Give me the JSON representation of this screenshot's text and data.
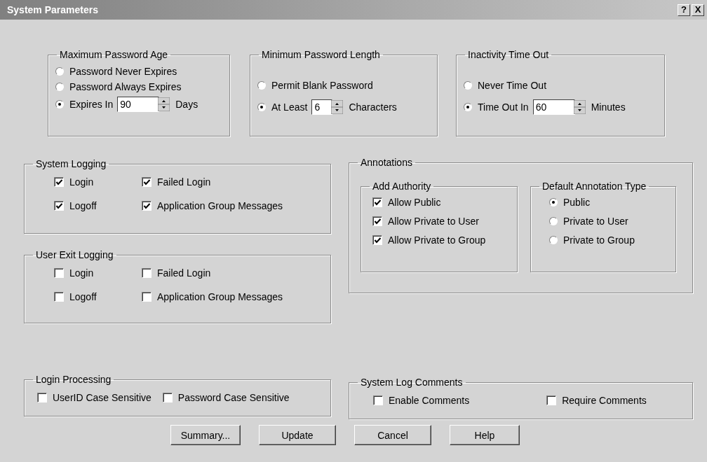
{
  "window": {
    "title": "System Parameters",
    "help_button": "?",
    "close_button": "X"
  },
  "top_groups": [
    {
      "title": "Maximum Password Age",
      "options": [
        {
          "label": "Password Never Expires",
          "selected": false
        },
        {
          "label": "Password Always Expires",
          "selected": false
        },
        {
          "label": "Expires In",
          "selected": true,
          "spin": {
            "value": "90",
            "unit": "Days"
          }
        }
      ]
    },
    {
      "title": "Minimum Password Length",
      "options": [
        {
          "label": "Permit Blank Password",
          "selected": false
        },
        {
          "label": "At Least",
          "selected": true,
          "spin": {
            "value": "6",
            "unit": "Characters"
          }
        }
      ]
    },
    {
      "title": "Inactivity Time Out",
      "options": [
        {
          "label": "Never Time Out",
          "selected": false
        },
        {
          "label": "Time Out In",
          "selected": true,
          "spin": {
            "value": "60",
            "unit": "Minutes"
          }
        }
      ]
    }
  ],
  "system_logging": {
    "title": "System Logging",
    "items": [
      {
        "label": "Login",
        "checked": true
      },
      {
        "label": "Failed Login",
        "checked": true
      },
      {
        "label": "Logoff",
        "checked": true
      },
      {
        "label": "Application Group Messages",
        "checked": true
      }
    ]
  },
  "user_exit_logging": {
    "title": "User Exit Logging",
    "items": [
      {
        "label": "Login",
        "checked": false
      },
      {
        "label": "Failed Login",
        "checked": false
      },
      {
        "label": "Logoff",
        "checked": false
      },
      {
        "label": "Application Group Messages",
        "checked": false
      }
    ]
  },
  "login_processing": {
    "title": "Login Processing",
    "items": [
      {
        "label": "UserID Case Sensitive",
        "checked": false
      },
      {
        "label": "Password Case Sensitive",
        "checked": false
      }
    ]
  },
  "annotations": {
    "title": "Annotations",
    "add_authority": {
      "title": "Add Authority",
      "items": [
        {
          "label": "Allow Public",
          "checked": true
        },
        {
          "label": "Allow Private to User",
          "checked": true
        },
        {
          "label": "Allow Private to Group",
          "checked": true
        }
      ]
    },
    "default_type": {
      "title": "Default Annotation Type",
      "options": [
        {
          "label": "Public",
          "selected": true
        },
        {
          "label": "Private to User",
          "selected": false
        },
        {
          "label": "Private to Group",
          "selected": false
        }
      ]
    }
  },
  "system_log_comments": {
    "title": "System Log Comments",
    "items": [
      {
        "label": "Enable Comments",
        "checked": false
      },
      {
        "label": "Require Comments",
        "checked": false
      }
    ]
  },
  "buttons": [
    "Summary...",
    "Update",
    "Cancel",
    "Help"
  ]
}
